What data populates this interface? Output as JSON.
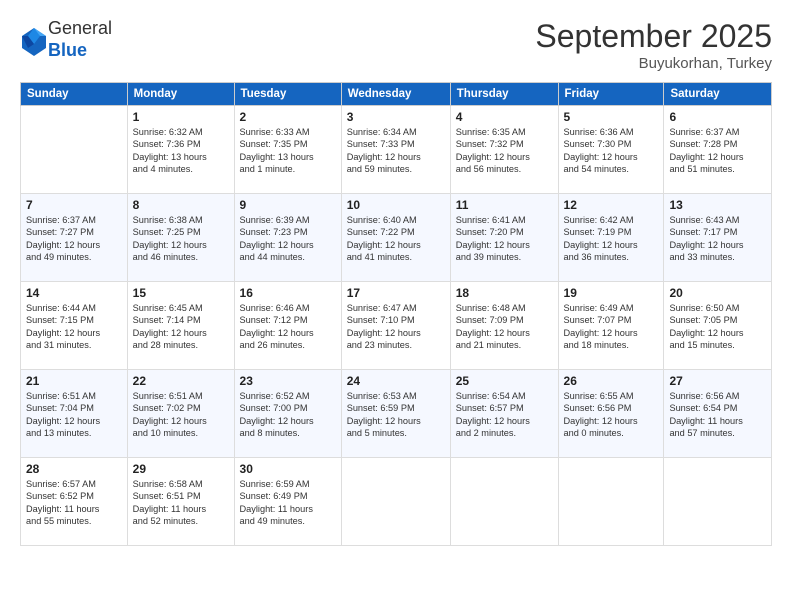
{
  "header": {
    "logo_line1": "General",
    "logo_line2": "Blue",
    "month": "September 2025",
    "location": "Buyukorhan, Turkey"
  },
  "weekdays": [
    "Sunday",
    "Monday",
    "Tuesday",
    "Wednesday",
    "Thursday",
    "Friday",
    "Saturday"
  ],
  "weeks": [
    [
      {
        "day": "",
        "info": ""
      },
      {
        "day": "1",
        "info": "Sunrise: 6:32 AM\nSunset: 7:36 PM\nDaylight: 13 hours\nand 4 minutes."
      },
      {
        "day": "2",
        "info": "Sunrise: 6:33 AM\nSunset: 7:35 PM\nDaylight: 13 hours\nand 1 minute."
      },
      {
        "day": "3",
        "info": "Sunrise: 6:34 AM\nSunset: 7:33 PM\nDaylight: 12 hours\nand 59 minutes."
      },
      {
        "day": "4",
        "info": "Sunrise: 6:35 AM\nSunset: 7:32 PM\nDaylight: 12 hours\nand 56 minutes."
      },
      {
        "day": "5",
        "info": "Sunrise: 6:36 AM\nSunset: 7:30 PM\nDaylight: 12 hours\nand 54 minutes."
      },
      {
        "day": "6",
        "info": "Sunrise: 6:37 AM\nSunset: 7:28 PM\nDaylight: 12 hours\nand 51 minutes."
      }
    ],
    [
      {
        "day": "7",
        "info": "Sunrise: 6:37 AM\nSunset: 7:27 PM\nDaylight: 12 hours\nand 49 minutes."
      },
      {
        "day": "8",
        "info": "Sunrise: 6:38 AM\nSunset: 7:25 PM\nDaylight: 12 hours\nand 46 minutes."
      },
      {
        "day": "9",
        "info": "Sunrise: 6:39 AM\nSunset: 7:23 PM\nDaylight: 12 hours\nand 44 minutes."
      },
      {
        "day": "10",
        "info": "Sunrise: 6:40 AM\nSunset: 7:22 PM\nDaylight: 12 hours\nand 41 minutes."
      },
      {
        "day": "11",
        "info": "Sunrise: 6:41 AM\nSunset: 7:20 PM\nDaylight: 12 hours\nand 39 minutes."
      },
      {
        "day": "12",
        "info": "Sunrise: 6:42 AM\nSunset: 7:19 PM\nDaylight: 12 hours\nand 36 minutes."
      },
      {
        "day": "13",
        "info": "Sunrise: 6:43 AM\nSunset: 7:17 PM\nDaylight: 12 hours\nand 33 minutes."
      }
    ],
    [
      {
        "day": "14",
        "info": "Sunrise: 6:44 AM\nSunset: 7:15 PM\nDaylight: 12 hours\nand 31 minutes."
      },
      {
        "day": "15",
        "info": "Sunrise: 6:45 AM\nSunset: 7:14 PM\nDaylight: 12 hours\nand 28 minutes."
      },
      {
        "day": "16",
        "info": "Sunrise: 6:46 AM\nSunset: 7:12 PM\nDaylight: 12 hours\nand 26 minutes."
      },
      {
        "day": "17",
        "info": "Sunrise: 6:47 AM\nSunset: 7:10 PM\nDaylight: 12 hours\nand 23 minutes."
      },
      {
        "day": "18",
        "info": "Sunrise: 6:48 AM\nSunset: 7:09 PM\nDaylight: 12 hours\nand 21 minutes."
      },
      {
        "day": "19",
        "info": "Sunrise: 6:49 AM\nSunset: 7:07 PM\nDaylight: 12 hours\nand 18 minutes."
      },
      {
        "day": "20",
        "info": "Sunrise: 6:50 AM\nSunset: 7:05 PM\nDaylight: 12 hours\nand 15 minutes."
      }
    ],
    [
      {
        "day": "21",
        "info": "Sunrise: 6:51 AM\nSunset: 7:04 PM\nDaylight: 12 hours\nand 13 minutes."
      },
      {
        "day": "22",
        "info": "Sunrise: 6:51 AM\nSunset: 7:02 PM\nDaylight: 12 hours\nand 10 minutes."
      },
      {
        "day": "23",
        "info": "Sunrise: 6:52 AM\nSunset: 7:00 PM\nDaylight: 12 hours\nand 8 minutes."
      },
      {
        "day": "24",
        "info": "Sunrise: 6:53 AM\nSunset: 6:59 PM\nDaylight: 12 hours\nand 5 minutes."
      },
      {
        "day": "25",
        "info": "Sunrise: 6:54 AM\nSunset: 6:57 PM\nDaylight: 12 hours\nand 2 minutes."
      },
      {
        "day": "26",
        "info": "Sunrise: 6:55 AM\nSunset: 6:56 PM\nDaylight: 12 hours\nand 0 minutes."
      },
      {
        "day": "27",
        "info": "Sunrise: 6:56 AM\nSunset: 6:54 PM\nDaylight: 11 hours\nand 57 minutes."
      }
    ],
    [
      {
        "day": "28",
        "info": "Sunrise: 6:57 AM\nSunset: 6:52 PM\nDaylight: 11 hours\nand 55 minutes."
      },
      {
        "day": "29",
        "info": "Sunrise: 6:58 AM\nSunset: 6:51 PM\nDaylight: 11 hours\nand 52 minutes."
      },
      {
        "day": "30",
        "info": "Sunrise: 6:59 AM\nSunset: 6:49 PM\nDaylight: 11 hours\nand 49 minutes."
      },
      {
        "day": "",
        "info": ""
      },
      {
        "day": "",
        "info": ""
      },
      {
        "day": "",
        "info": ""
      },
      {
        "day": "",
        "info": ""
      }
    ]
  ]
}
